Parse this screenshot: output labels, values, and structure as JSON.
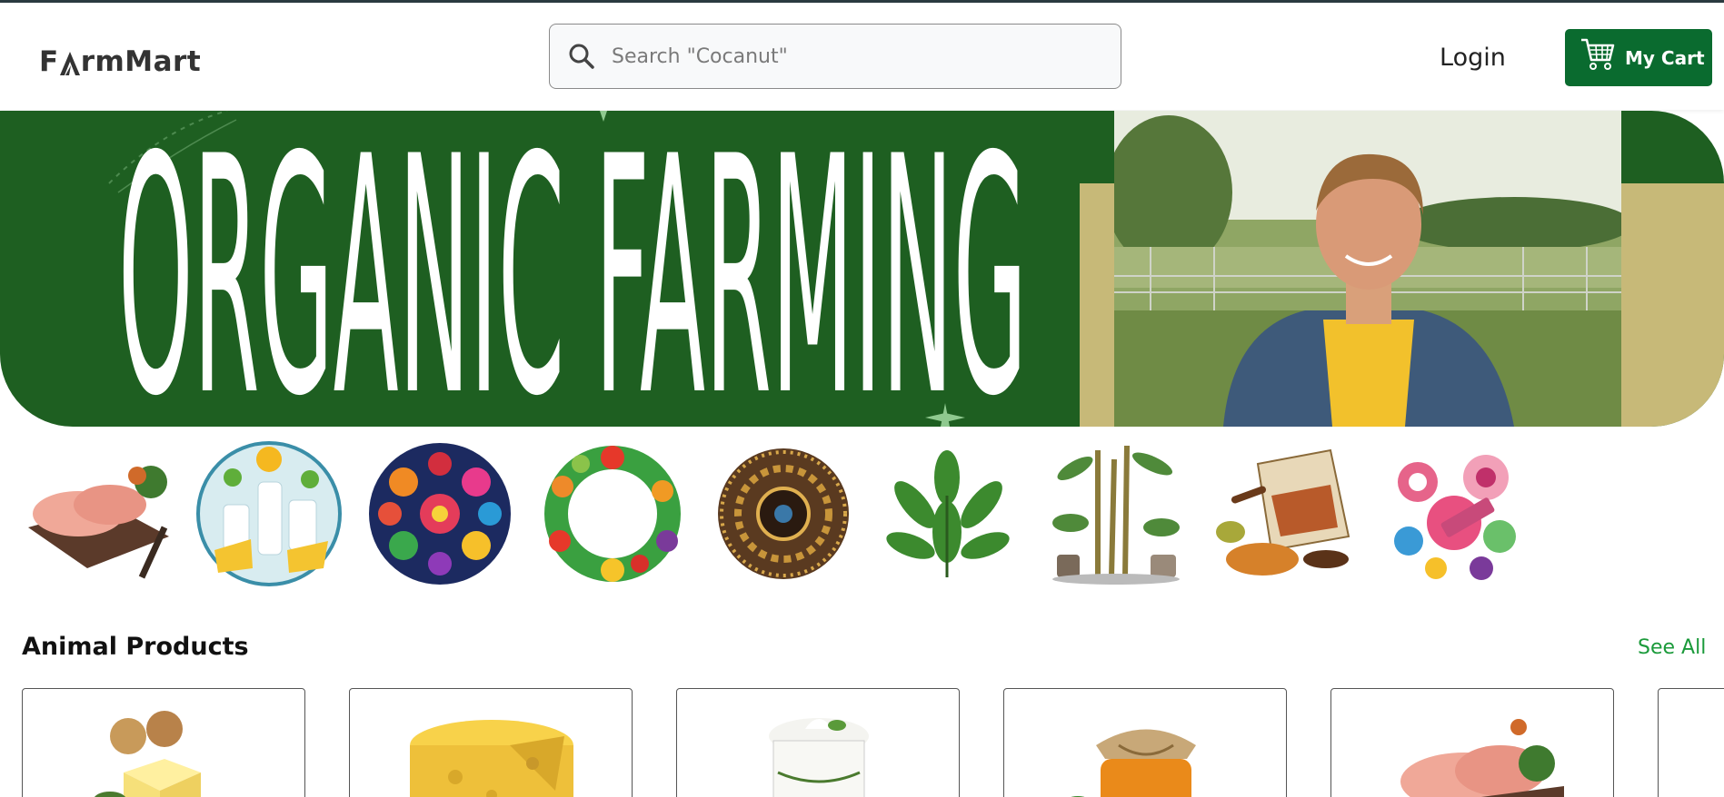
{
  "header": {
    "logo_text_left": "F",
    "logo_text_right": "rmMart",
    "search_placeholder": "Search \"Cocanut\"",
    "login_label": "Login",
    "cart_label": "My Cart"
  },
  "banner": {
    "headline": "ORGANIC FARMING"
  },
  "categories": [
    {
      "icon": "meat-category-icon"
    },
    {
      "icon": "dairy-category-icon"
    },
    {
      "icon": "flowers-category-icon"
    },
    {
      "icon": "fruits-vegetables-category-icon"
    },
    {
      "icon": "grains-category-icon"
    },
    {
      "icon": "herbs-category-icon"
    },
    {
      "icon": "plants-category-icon"
    },
    {
      "icon": "spices-category-icon"
    },
    {
      "icon": "sweets-category-icon"
    }
  ],
  "section": {
    "title": "Animal Products",
    "see_all": "See All"
  },
  "products": [
    {
      "icon": "butter-icon"
    },
    {
      "icon": "cheese-icon"
    },
    {
      "icon": "yogurt-icon"
    },
    {
      "icon": "honey-icon"
    },
    {
      "icon": "chicken-icon"
    }
  ],
  "colors": {
    "brand_green": "#0a6b2f",
    "banner_green": "#1e5f21",
    "banner_gold": "#c7b978",
    "link_green": "#1a9a3a"
  }
}
